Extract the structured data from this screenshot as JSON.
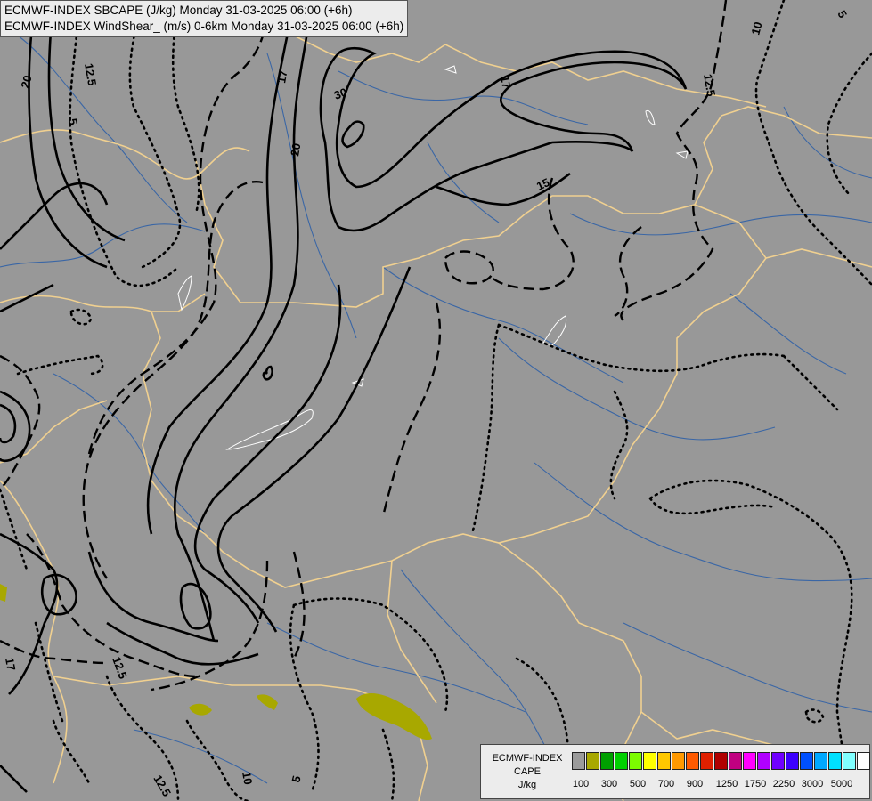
{
  "header": {
    "line1": "ECMWF-INDEX SBCAPE (J/kg) Monday 31-03-2025 06:00 (+6h)",
    "line2": "ECMWF-INDEX WindShear_ (m/s) 0-6km Monday 31-03-2025 06:00 (+6h)"
  },
  "contour_labels": [
    "20",
    "12.5",
    "5",
    "17",
    "20",
    "30",
    "17",
    "15",
    "12.5",
    "10",
    "5",
    "17",
    "12.5",
    "12.5",
    "10",
    "5"
  ],
  "legend": {
    "title_lines": [
      "ECMWF-INDEX",
      "CAPE",
      "J/kg"
    ],
    "colors": [
      "#9b9b9b",
      "#a8a800",
      "#00a000",
      "#00d000",
      "#7cfc00",
      "#ffff00",
      "#ffc800",
      "#ff9900",
      "#ff5a00",
      "#e02000",
      "#b00000",
      "#c00080",
      "#ff00ff",
      "#b000ff",
      "#7000ff",
      "#3c00ff",
      "#0050ff",
      "#00a8ff",
      "#00e0ff",
      "#80ffff",
      "#ffffff"
    ],
    "ticks": [
      "100",
      "300",
      "500",
      "700",
      "900",
      "1250",
      "1750",
      "2250",
      "3000",
      "5000"
    ]
  },
  "colors": {
    "background": "#989898",
    "cape_low": "#a8a800",
    "border": "#f0d090",
    "river": "#2a5ea8"
  }
}
